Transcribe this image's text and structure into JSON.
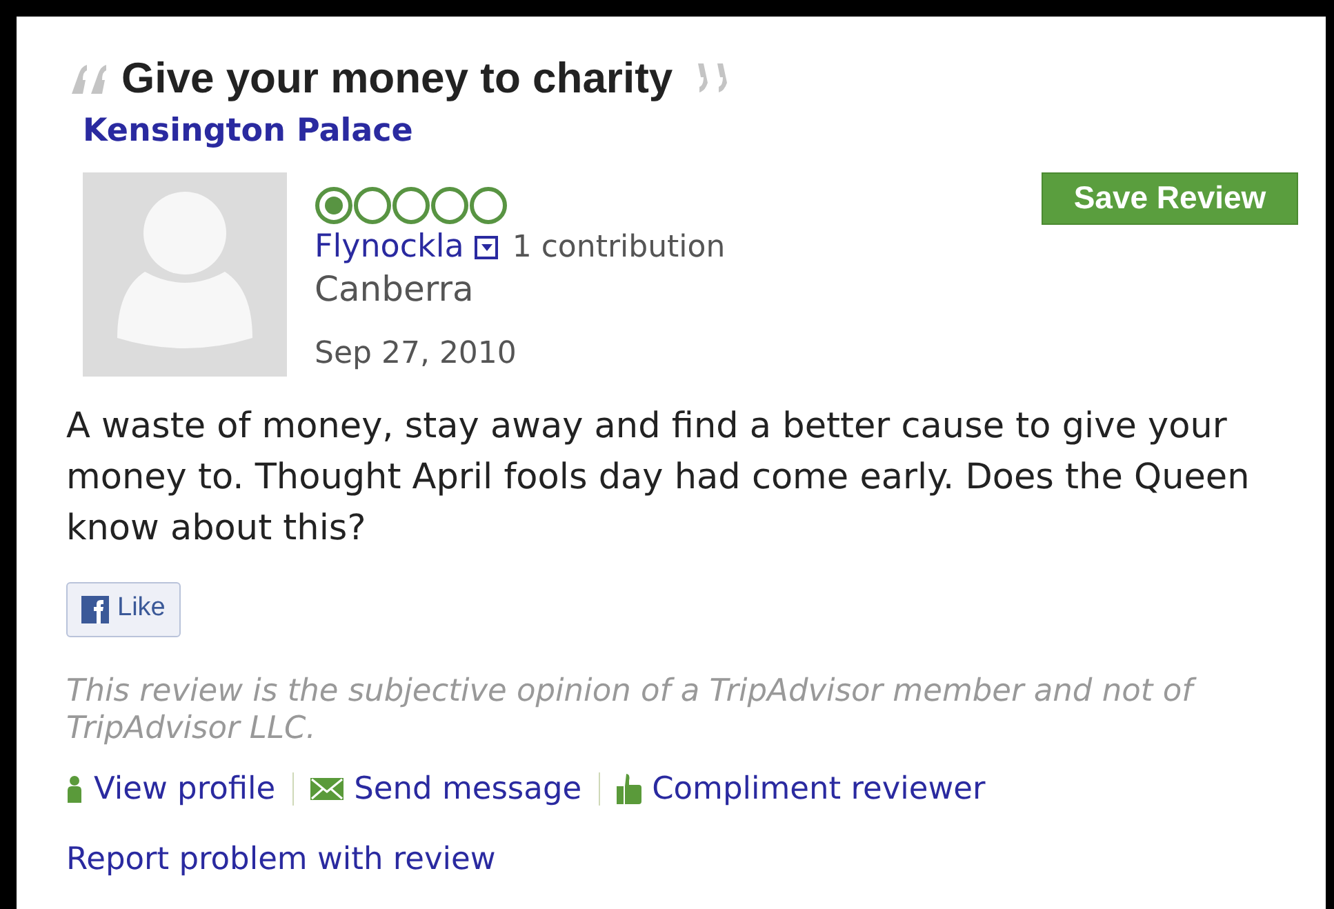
{
  "review": {
    "title": "Give your money to charity",
    "place": "Kensington Palace",
    "reviewer": {
      "name": "Flynockla",
      "contributions": "1 contribution",
      "location": "Canberra"
    },
    "stars": 1,
    "date": "Sep 27, 2010",
    "save_button": "Save Review",
    "body": "A waste of money, stay away and find a better cause to give your money to. Thought April fools day had come early. Does the Queen know about this?",
    "like_button": "Like",
    "disclaimer": "This review is the subjective opinion of a TripAdvisor member and not of TripAdvisor LLC.",
    "actions": [
      {
        "kind": "profile",
        "label": "View profile"
      },
      {
        "kind": "message",
        "label": "Send message"
      },
      {
        "kind": "compliment",
        "label": "Compliment reviewer"
      }
    ],
    "report_link": "Report problem with review"
  }
}
